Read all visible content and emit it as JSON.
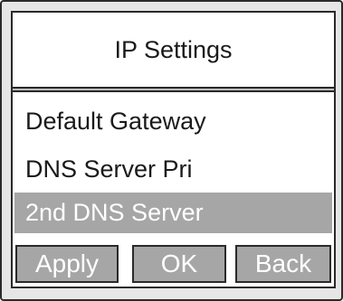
{
  "screen": {
    "title": "IP Settings"
  },
  "menu": {
    "items": [
      {
        "label": "Default Gateway",
        "selected": false
      },
      {
        "label": "DNS Server Pri",
        "selected": false
      },
      {
        "label": "2nd DNS Server",
        "selected": true
      }
    ]
  },
  "softkeys": {
    "apply": "Apply",
    "ok": "OK",
    "back": "Back"
  },
  "colors": {
    "highlight": "#a6a6a6",
    "border": "#2a2a2a",
    "device_bezel": "#e6e6e6"
  }
}
